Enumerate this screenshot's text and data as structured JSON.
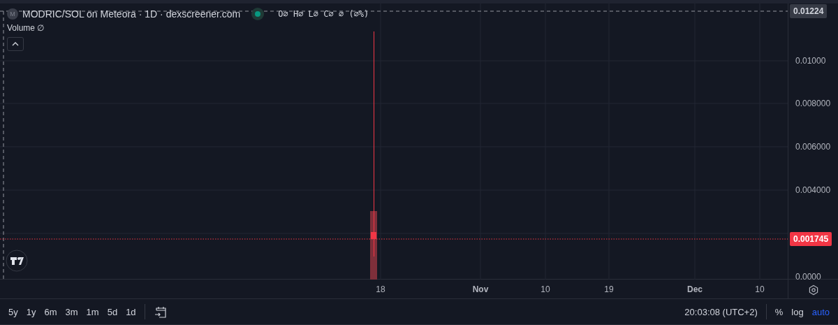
{
  "legend": {
    "avatar": "M",
    "title": "MODRIC/SOL on Meteora · 1D · dexscreener.com",
    "market_open": true,
    "ohlc": "O∅ H∅ L∅ C∅ ∅ (∅%)",
    "volume": "Volume  ∅"
  },
  "price_axis": {
    "high_tag": "0.01224",
    "ticks": [
      "0.01000",
      "0.008000",
      "0.006000",
      "0.004000",
      "0.0000"
    ],
    "last_price_tag": "0.001745"
  },
  "time_axis": {
    "labels": [
      "18",
      "Nov",
      "10",
      "19",
      "Dec",
      "10"
    ]
  },
  "ranges": [
    {
      "label": "5y"
    },
    {
      "label": "1y"
    },
    {
      "label": "6m"
    },
    {
      "label": "3m"
    },
    {
      "label": "1m"
    },
    {
      "label": "5d"
    },
    {
      "label": "1d"
    }
  ],
  "clock": "20:03:08 (UTC+2)",
  "scale_toggles": [
    {
      "label": "%",
      "selected": false
    },
    {
      "label": "log",
      "selected": false
    },
    {
      "label": "auto",
      "selected": true
    }
  ]
}
